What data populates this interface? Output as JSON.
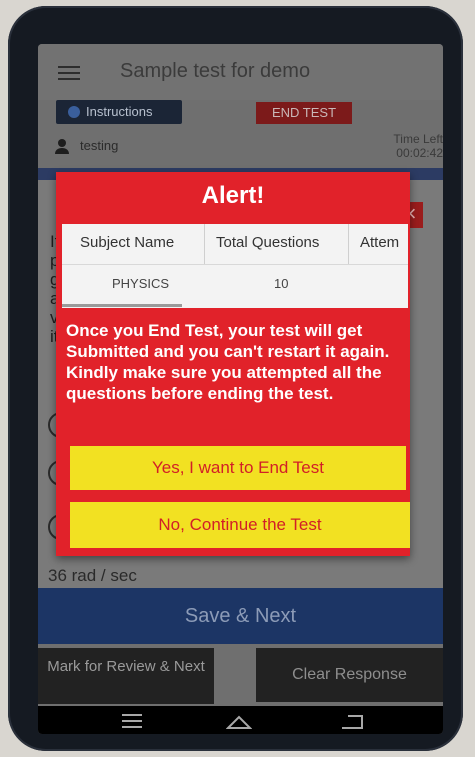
{
  "app": {
    "title": "Sample test for demo",
    "instructions_label": "Instructions",
    "end_test_label": "END TEST",
    "user_name": "testing",
    "time_left_label": "Time Left",
    "time_left_value": "00:02:42",
    "question_prefix": "If pa gi ar ve its",
    "last_option": "36 rad / sec",
    "save_next_label": "Save & Next",
    "mark_review_label": "Mark for Review & Next",
    "clear_response_label": "Clear Response"
  },
  "alert": {
    "title": "Alert!",
    "table": {
      "headers": [
        "Subject Name",
        "Total Questions",
        "Attem"
      ],
      "rows": [
        [
          "PHYSICS",
          "10",
          ""
        ]
      ]
    },
    "message": "Once you End Test, your test will get Submitted and you can't restart it again. Kindly make sure you attempted all the questions before ending the test.",
    "yes_label": "Yes, I want to End Test",
    "no_label": "No, Continue the Test"
  },
  "navbar": {
    "icons": [
      "menu-icon",
      "home-icon",
      "back-icon"
    ]
  },
  "colors": {
    "alert_red": "#e1222a",
    "button_yellow": "#f2e122",
    "button_text_red": "#d21f27",
    "save_blue": "#1c3565"
  }
}
